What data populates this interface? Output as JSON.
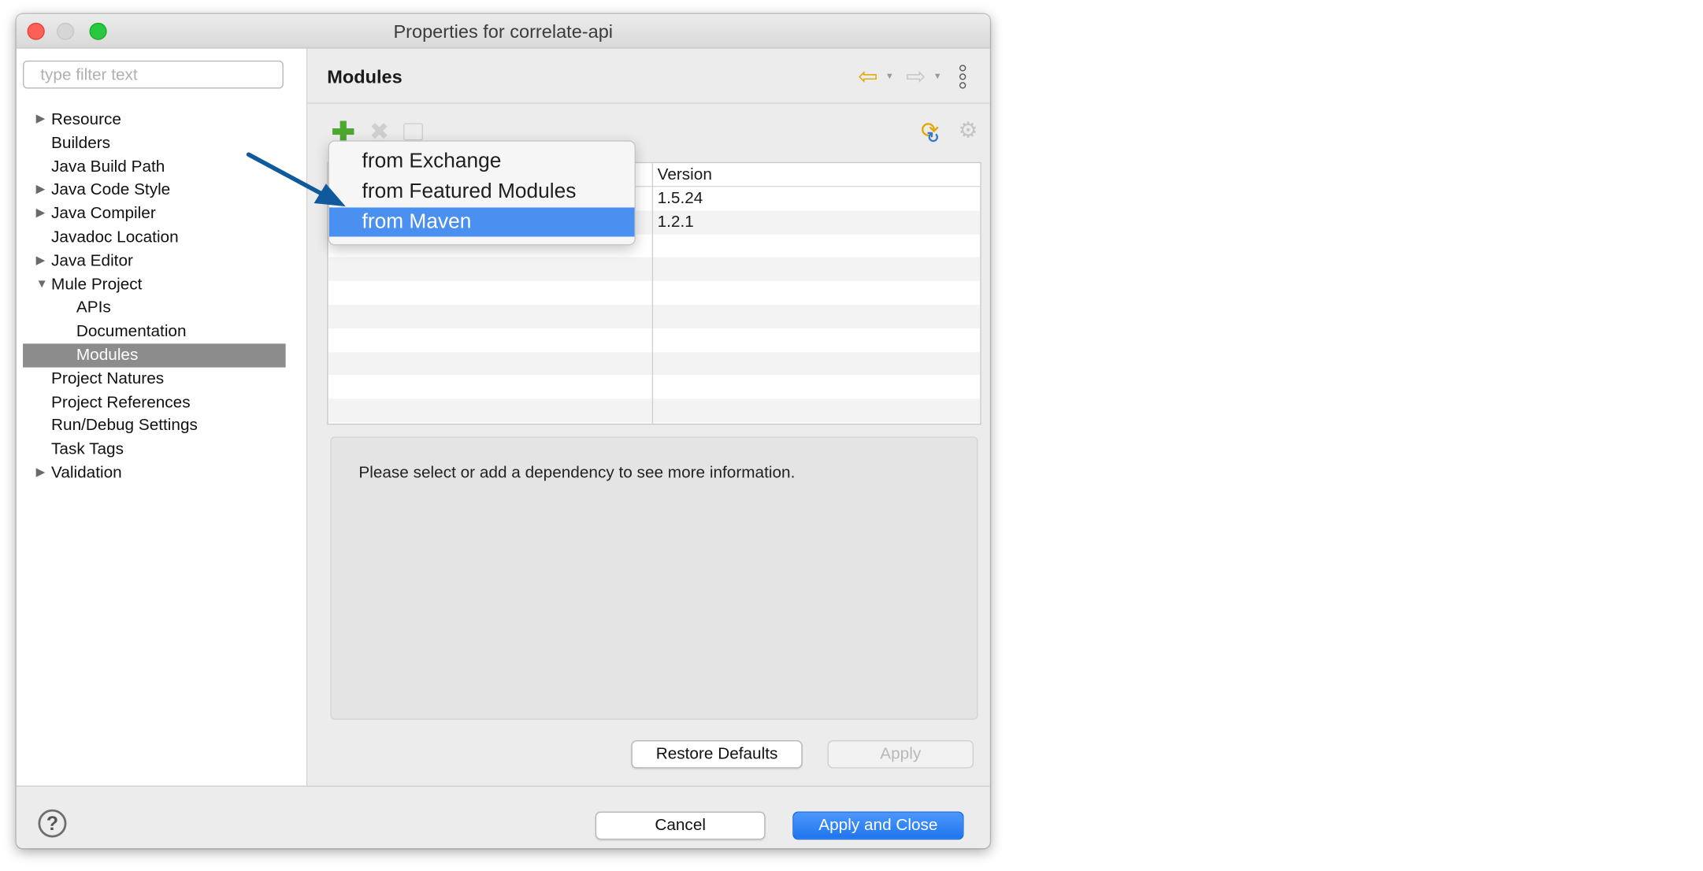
{
  "window": {
    "title": "Properties for correlate-api"
  },
  "sidebar": {
    "filter_placeholder": "type filter text",
    "items": [
      {
        "label": "Resource",
        "expander": "▶"
      },
      {
        "label": "Builders"
      },
      {
        "label": "Java Build Path"
      },
      {
        "label": "Java Code Style",
        "expander": "▶"
      },
      {
        "label": "Java Compiler",
        "expander": "▶"
      },
      {
        "label": "Javadoc Location"
      },
      {
        "label": "Java Editor",
        "expander": "▶"
      },
      {
        "label": "Mule Project",
        "expander": "▼"
      },
      {
        "label": "APIs"
      },
      {
        "label": "Documentation"
      },
      {
        "label": "Modules",
        "selected": true
      },
      {
        "label": "Project Natures"
      },
      {
        "label": "Project References"
      },
      {
        "label": "Run/Debug Settings"
      },
      {
        "label": "Task Tags"
      },
      {
        "label": "Validation",
        "expander": "▶"
      }
    ]
  },
  "main": {
    "title": "Modules",
    "toolbar_icons": [
      "add-icon",
      "remove-icon",
      "edit-icon",
      "refresh-icon",
      "gear-icon"
    ],
    "nav_icons": [
      "back-arrow-icon",
      "forward-arrow-icon",
      "view-menu-icon"
    ],
    "table": {
      "columns": [
        "",
        "Version"
      ],
      "rows": [
        {
          "name": "",
          "version": "1.5.24"
        },
        {
          "name": "",
          "version": "1.2.1"
        }
      ]
    },
    "info_text": "Please select or add a dependency to see more information.",
    "restore_defaults": "Restore Defaults",
    "apply": "Apply"
  },
  "menu": {
    "items": [
      "from Exchange",
      "from Featured Modules",
      "from Maven"
    ],
    "highlighted": "from Maven"
  },
  "footer": {
    "help_icon": "?",
    "cancel": "Cancel",
    "apply_and_close": "Apply and Close"
  },
  "colors": {
    "accent": "#1f75ee",
    "menu_highlight": "#4a90f0",
    "selection": "#8c8c8c",
    "annotation_arrow": "#0f5a9c"
  }
}
